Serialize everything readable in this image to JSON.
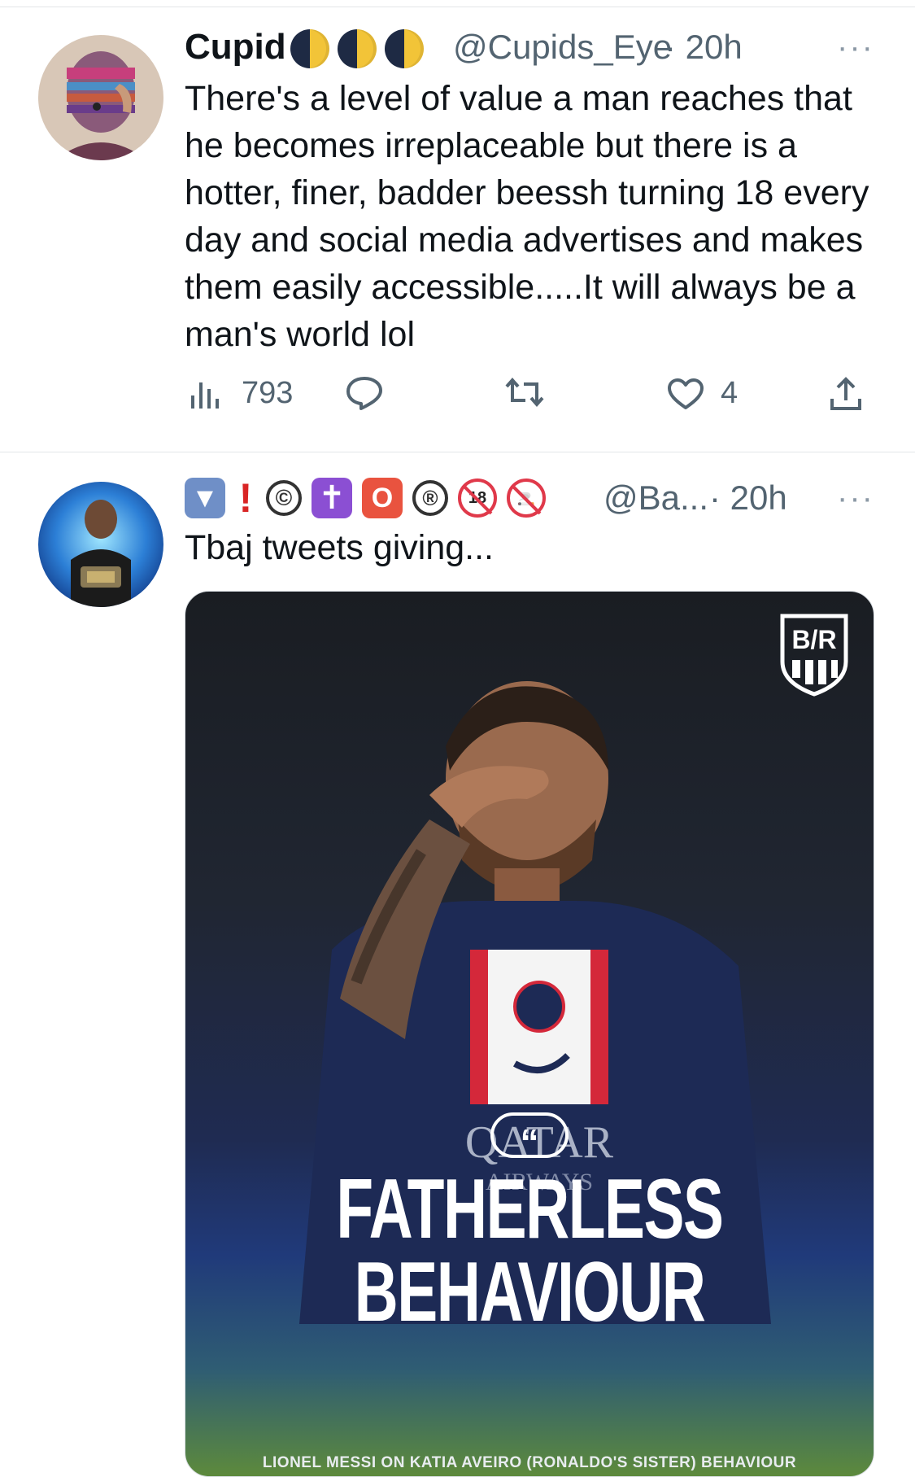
{
  "tweets": [
    {
      "display_name": "Cupid",
      "name_emojis": [
        "moon-icon",
        "moon-icon",
        "moon-icon"
      ],
      "handle": "@Cupids_Eye",
      "time": "· 20h",
      "more": "···",
      "text": "There's a level of value a man reaches that he becomes irreplaceable but there is a hotter, finer, badder beessh turning 18 every day and social media advertises and makes them easily accessible.....It will always be a man's world lol",
      "views": "793",
      "replies": "",
      "retweets": "",
      "likes": "4"
    },
    {
      "display_name_badges": [
        "triangle-down-icon",
        "exclamation-icon",
        "copyright-icon",
        "latin-cross-icon",
        "o-button-icon",
        "registered-icon",
        "no-under-18-icon",
        "no-smoking-icon"
      ],
      "badge_glyphs": [
        "▼",
        "!",
        "©",
        "✝",
        "O",
        "®",
        "18",
        "🚬"
      ],
      "handle": "@Ba...",
      "time": "· 20h",
      "more": "···",
      "text": "Tbaj tweets giving...",
      "media": {
        "logo_text": "B/R",
        "quote_glyph": "“",
        "headline_line1": "FATHERLESS",
        "headline_line2": "BEHAVIOUR",
        "caption": "LIONEL MESSI ON KATIA AVEIRO (RONALDO'S SISTER) BEHAVIOUR",
        "jersey_text": "QATAR",
        "jersey_sub": "AIRWAYS",
        "colors": {
          "jersey": "#1d2a55",
          "stripe_red": "#d4283a",
          "stripe_white": "#f4f4f4"
        }
      }
    }
  ],
  "colors": {
    "text": "#0f1419",
    "muted": "#536471",
    "divider": "#e3e6e8"
  }
}
